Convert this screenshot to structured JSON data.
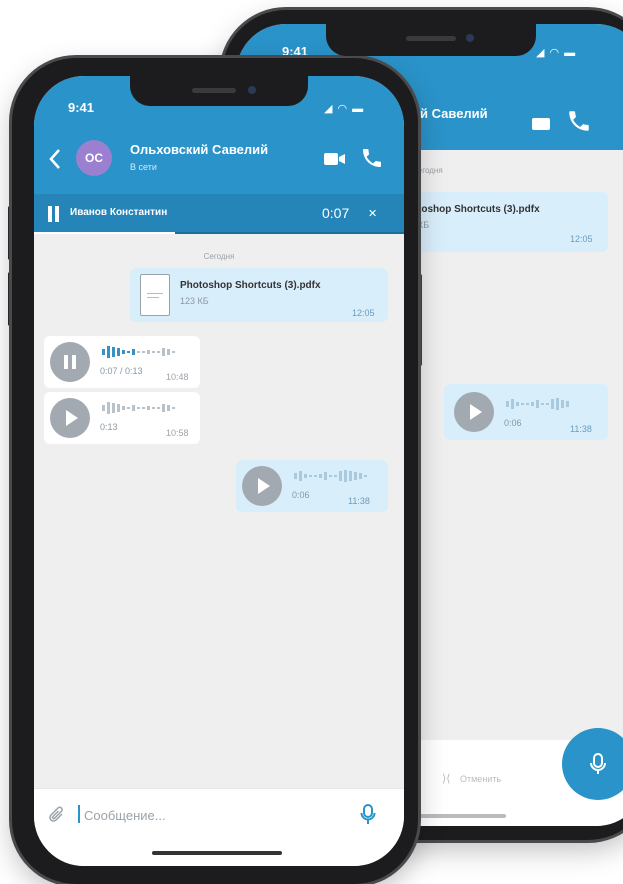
{
  "status_bar": {
    "time": "9:41",
    "icons": "◢ ◠ ▬"
  },
  "chat": {
    "avatar_initials": "ОС",
    "contact_name": "Ольховский Савелий",
    "contact_status": "В сети",
    "back_icon": "chevron-left-icon",
    "video_icon": "video-camera-icon",
    "phone_icon": "phone-icon"
  },
  "player": {
    "name": "Иванов Константин",
    "time": "0:07",
    "close": "✕"
  },
  "date_separator": "Сегодня",
  "messages": {
    "file": {
      "name": "Photoshop Shortcuts (3).pdfx",
      "size": "123 КБ",
      "time": "12:05"
    },
    "voice1": {
      "progress": "0:07 / 0:13",
      "time": "10:48"
    },
    "voice2": {
      "duration": "0:13",
      "time": "10:58"
    },
    "voice3": {
      "duration": "0:06",
      "time": "11:38"
    }
  },
  "input": {
    "placeholder": "Сообщение...",
    "attach_icon": "paperclip-icon",
    "mic_icon": "microphone-icon"
  },
  "back_phone": {
    "time": "9:41",
    "contact_name_partial": "ий Савелий",
    "date_separator": "Сегодня",
    "file_name_partial": "toshop Shortcuts (3).pdfx",
    "file_size_partial": "КБ",
    "file_time": "12:05",
    "voice_duration": "0:06",
    "voice_time": "11:38",
    "cancel_label": "Отменить"
  },
  "colors": {
    "header": "#2a93c9",
    "outgoing_bubble": "#d9eefb",
    "avatar": "#9b7fd1",
    "accent": "#2a93c9"
  }
}
